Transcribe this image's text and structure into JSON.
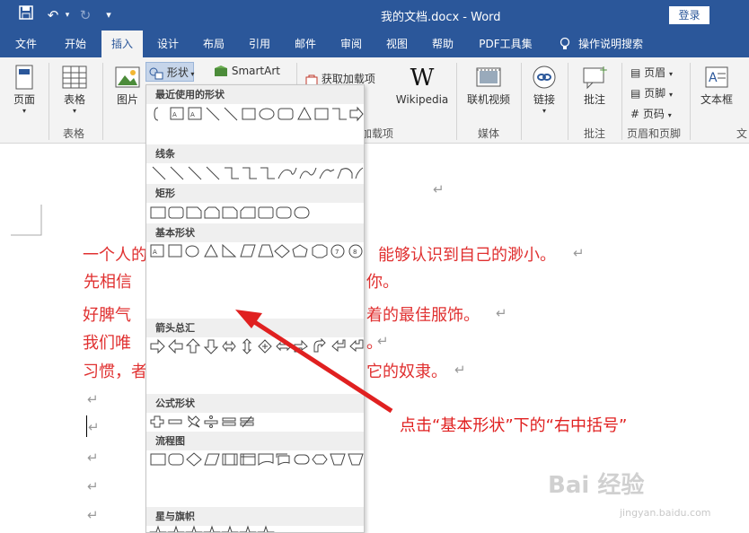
{
  "title_bar": {
    "doc_title": "我的文档.docx  -  Word",
    "login_label": "登录"
  },
  "tabs": [
    "文件",
    "开始",
    "插入",
    "设计",
    "布局",
    "引用",
    "邮件",
    "审阅",
    "视图",
    "帮助",
    "PDF工具集",
    "操作说明搜索"
  ],
  "ribbon": {
    "page_label": "页面",
    "table_label": "表格",
    "table_group": "表格",
    "picture_label": "图片",
    "shapes_label": "形状",
    "smartart_label": "SmartArt",
    "get_addins_label": "获取加载项",
    "addins_group": "加载项",
    "wikipedia_label": "Wikipedia",
    "video_label": "联机视频",
    "media_group": "媒体",
    "link_label": "链接",
    "comment_label": "批注",
    "comment_group": "批注",
    "header_label": "页眉",
    "footer_label": "页脚",
    "pagenum_label": "页码",
    "header_footer_group": "页眉和页脚",
    "textbox_label": "文本框",
    "text_group_partial": "文"
  },
  "document": {
    "lines": [
      "一个人的",
      "先相信",
      "好脾气",
      "我们唯",
      "习惯，者"
    ],
    "lines_right": [
      "能够认识到自己的渺小。",
      "你。",
      "着的最佳服饰。",
      "。",
      "它的奴隶。"
    ]
  },
  "shapes_panel": {
    "sections": [
      "最近使用的形状",
      "线条",
      "矩形",
      "基本形状",
      "箭头总汇",
      "公式形状",
      "流程图",
      "星与旗帜"
    ]
  },
  "annotation": "点击“基本形状”下的“右中括号”",
  "watermark": {
    "brand": "Bai 经验",
    "url": "jingyan.baidu.com"
  },
  "colors": {
    "brand": "#2b579a",
    "red_text": "#e03030",
    "highlight": "#e02020"
  }
}
